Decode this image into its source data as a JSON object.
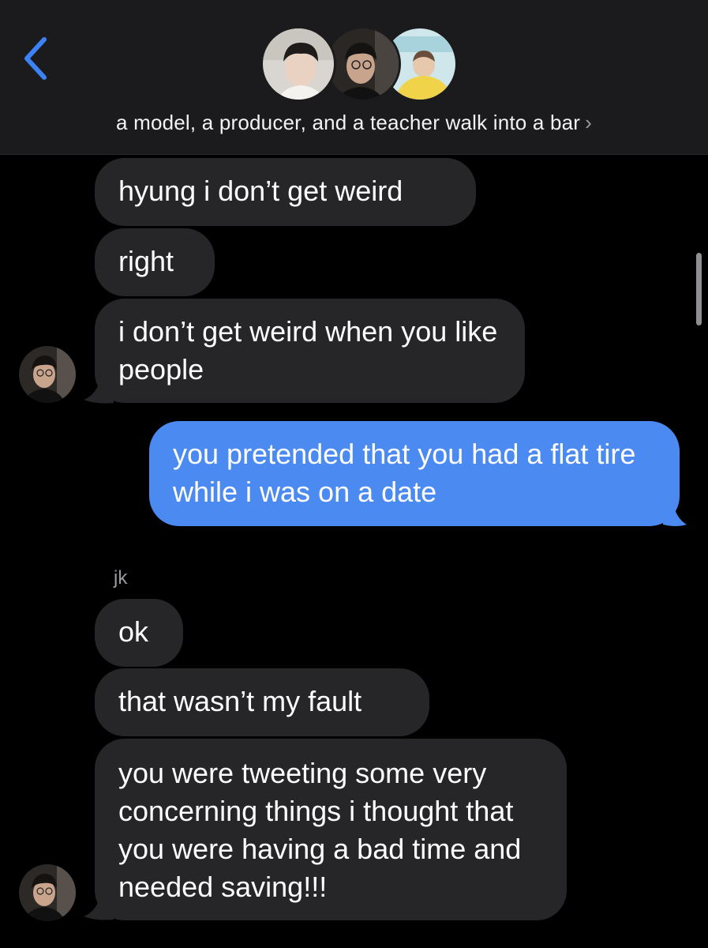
{
  "header": {
    "back_icon": "chevron-left-icon",
    "group_name": "a model, a producer, and a teacher walk into a bar",
    "chevron": "›",
    "accent_color": "#3d82f5"
  },
  "messages": [
    {
      "direction": "incoming",
      "text": "hyung i don’t get weird"
    },
    {
      "direction": "incoming",
      "text": "right"
    },
    {
      "direction": "incoming",
      "text": "i don’t get weird when you like people"
    },
    {
      "direction": "outgoing",
      "text": "you pretended that you had a flat tire while i was on a date"
    },
    {
      "direction": "incoming",
      "sender": "jk",
      "text": "ok"
    },
    {
      "direction": "incoming",
      "text": "that wasn’t my fault"
    },
    {
      "direction": "incoming",
      "text": "you were tweeting some very concerning things i thought that you were having a bad time and needed saving!!!"
    }
  ],
  "colors": {
    "incoming_bubble": "#262629",
    "outgoing_bubble": "#4b8af0",
    "header_bg": "#1b1b1d"
  }
}
